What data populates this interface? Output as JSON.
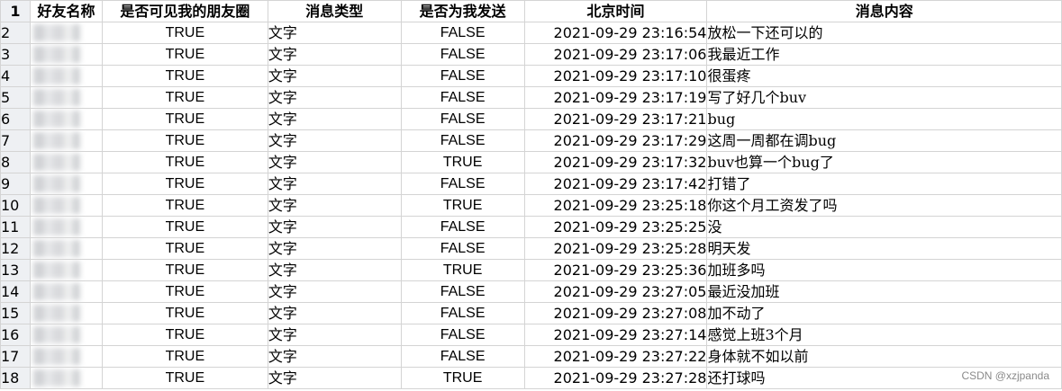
{
  "headers": {
    "row_number": "1",
    "friend_name": "好友名称",
    "visible_to_moments": "是否可见我的朋友圈",
    "message_type": "消息类型",
    "sent_by_me": "是否为我发送",
    "beijing_time": "北京时间",
    "message_content": "消息内容"
  },
  "rows": [
    {
      "num": "2",
      "visible": "TRUE",
      "type": "文字",
      "sent": "FALSE",
      "time": "2021-09-29 23:16:54",
      "content": "放松一下还可以的"
    },
    {
      "num": "3",
      "visible": "TRUE",
      "type": "文字",
      "sent": "FALSE",
      "time": "2021-09-29 23:17:06",
      "content": "我最近工作"
    },
    {
      "num": "4",
      "visible": "TRUE",
      "type": "文字",
      "sent": "FALSE",
      "time": "2021-09-29 23:17:10",
      "content": "很蛋疼"
    },
    {
      "num": "5",
      "visible": "TRUE",
      "type": "文字",
      "sent": "FALSE",
      "time": "2021-09-29 23:17:19",
      "content": "写了好几个buv"
    },
    {
      "num": "6",
      "visible": "TRUE",
      "type": "文字",
      "sent": "FALSE",
      "time": "2021-09-29 23:17:21",
      "content": "bug"
    },
    {
      "num": "7",
      "visible": "TRUE",
      "type": "文字",
      "sent": "FALSE",
      "time": "2021-09-29 23:17:29",
      "content": "这周一周都在调bug"
    },
    {
      "num": "8",
      "visible": "TRUE",
      "type": "文字",
      "sent": "TRUE",
      "time": "2021-09-29 23:17:32",
      "content": "buv也算一个bug了"
    },
    {
      "num": "9",
      "visible": "TRUE",
      "type": "文字",
      "sent": "FALSE",
      "time": "2021-09-29 23:17:42",
      "content": "打错了"
    },
    {
      "num": "10",
      "visible": "TRUE",
      "type": "文字",
      "sent": "TRUE",
      "time": "2021-09-29 23:25:18",
      "content": "你这个月工资发了吗"
    },
    {
      "num": "11",
      "visible": "TRUE",
      "type": "文字",
      "sent": "FALSE",
      "time": "2021-09-29 23:25:25",
      "content": "没"
    },
    {
      "num": "12",
      "visible": "TRUE",
      "type": "文字",
      "sent": "FALSE",
      "time": "2021-09-29 23:25:28",
      "content": "明天发"
    },
    {
      "num": "13",
      "visible": "TRUE",
      "type": "文字",
      "sent": "TRUE",
      "time": "2021-09-29 23:25:36",
      "content": "加班多吗"
    },
    {
      "num": "14",
      "visible": "TRUE",
      "type": "文字",
      "sent": "FALSE",
      "time": "2021-09-29 23:27:05",
      "content": "最近没加班"
    },
    {
      "num": "15",
      "visible": "TRUE",
      "type": "文字",
      "sent": "FALSE",
      "time": "2021-09-29 23:27:08",
      "content": "加不动了"
    },
    {
      "num": "16",
      "visible": "TRUE",
      "type": "文字",
      "sent": "FALSE",
      "time": "2021-09-29 23:27:14",
      "content": "感觉上班3个月"
    },
    {
      "num": "17",
      "visible": "TRUE",
      "type": "文字",
      "sent": "FALSE",
      "time": "2021-09-29 23:27:22",
      "content": "身体就不如以前"
    },
    {
      "num": "18",
      "visible": "TRUE",
      "type": "文字",
      "sent": "TRUE",
      "time": "2021-09-29 23:27:28",
      "content": "还打球吗"
    }
  ],
  "watermark": "CSDN @xzjpanda"
}
